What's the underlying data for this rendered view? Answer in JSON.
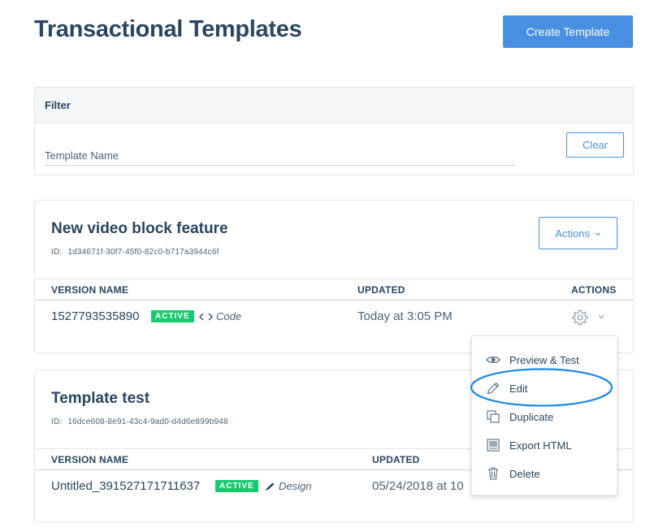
{
  "page": {
    "title": "Transactional Templates"
  },
  "header": {
    "create_label": "Create Template"
  },
  "filter": {
    "heading": "Filter",
    "template_name_placeholder": "Template Name",
    "clear_label": "Clear"
  },
  "templates": [
    {
      "name": "New video block feature",
      "id_label": "ID:",
      "id": "1d34671f-30f7-45f0-82c0-b717a3944c6f",
      "actions_label": "Actions",
      "columns": {
        "version": "VERSION NAME",
        "updated": "UPDATED",
        "actions": "ACTIONS"
      },
      "version": {
        "name": "1527793535890",
        "status": "ACTIVE",
        "editor_icon": "code-icon",
        "editor": "Code",
        "updated": "Today at 3:05 PM"
      }
    },
    {
      "name": "Template test",
      "id_label": "ID:",
      "id": "16dce608-8e91-43c4-9ad0-d4d6e899b948",
      "columns": {
        "version": "VERSION NAME",
        "updated": "UPDATED"
      },
      "version": {
        "name": "Untitled_391527171711637",
        "status": "ACTIVE",
        "editor_icon": "pencil-icon",
        "editor": "Design",
        "updated": "05/24/2018 at 10"
      }
    }
  ],
  "dropdown_menu": [
    {
      "icon": "eye-icon",
      "label": "Preview & Test"
    },
    {
      "icon": "pencil-icon",
      "label": "Edit"
    },
    {
      "icon": "duplicate-icon",
      "label": "Duplicate"
    },
    {
      "icon": "export-html-icon",
      "label": "Export HTML"
    },
    {
      "icon": "trash-icon",
      "label": "Delete"
    }
  ],
  "colors": {
    "primary": "#4a90e2",
    "text_dark": "#294661",
    "active_badge": "#18c96e",
    "highlight_ring": "#1e88e5"
  }
}
